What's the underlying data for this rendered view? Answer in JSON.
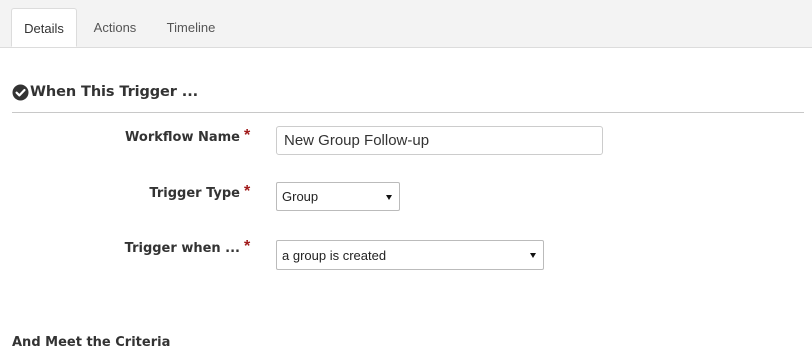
{
  "tabs": [
    {
      "label": "Details",
      "active": true
    },
    {
      "label": "Actions",
      "active": false
    },
    {
      "label": "Timeline",
      "active": false
    }
  ],
  "section": {
    "title": "When This Trigger ...",
    "icon": "check-circle-icon"
  },
  "form": {
    "workflow_name": {
      "label": "Workflow Name",
      "required_marker": "*",
      "value": "New Group Follow-up"
    },
    "trigger_type": {
      "label": "Trigger Type",
      "required_marker": "*",
      "selected": "Group"
    },
    "trigger_when": {
      "label": "Trigger when ...",
      "required_marker": "*",
      "selected": "a group is created"
    }
  },
  "criteria": {
    "heading": "And Meet the Criteria"
  },
  "colors": {
    "required": "#a01a1a",
    "tab_bar_bg": "#f3f3f3",
    "text": "#333333"
  }
}
